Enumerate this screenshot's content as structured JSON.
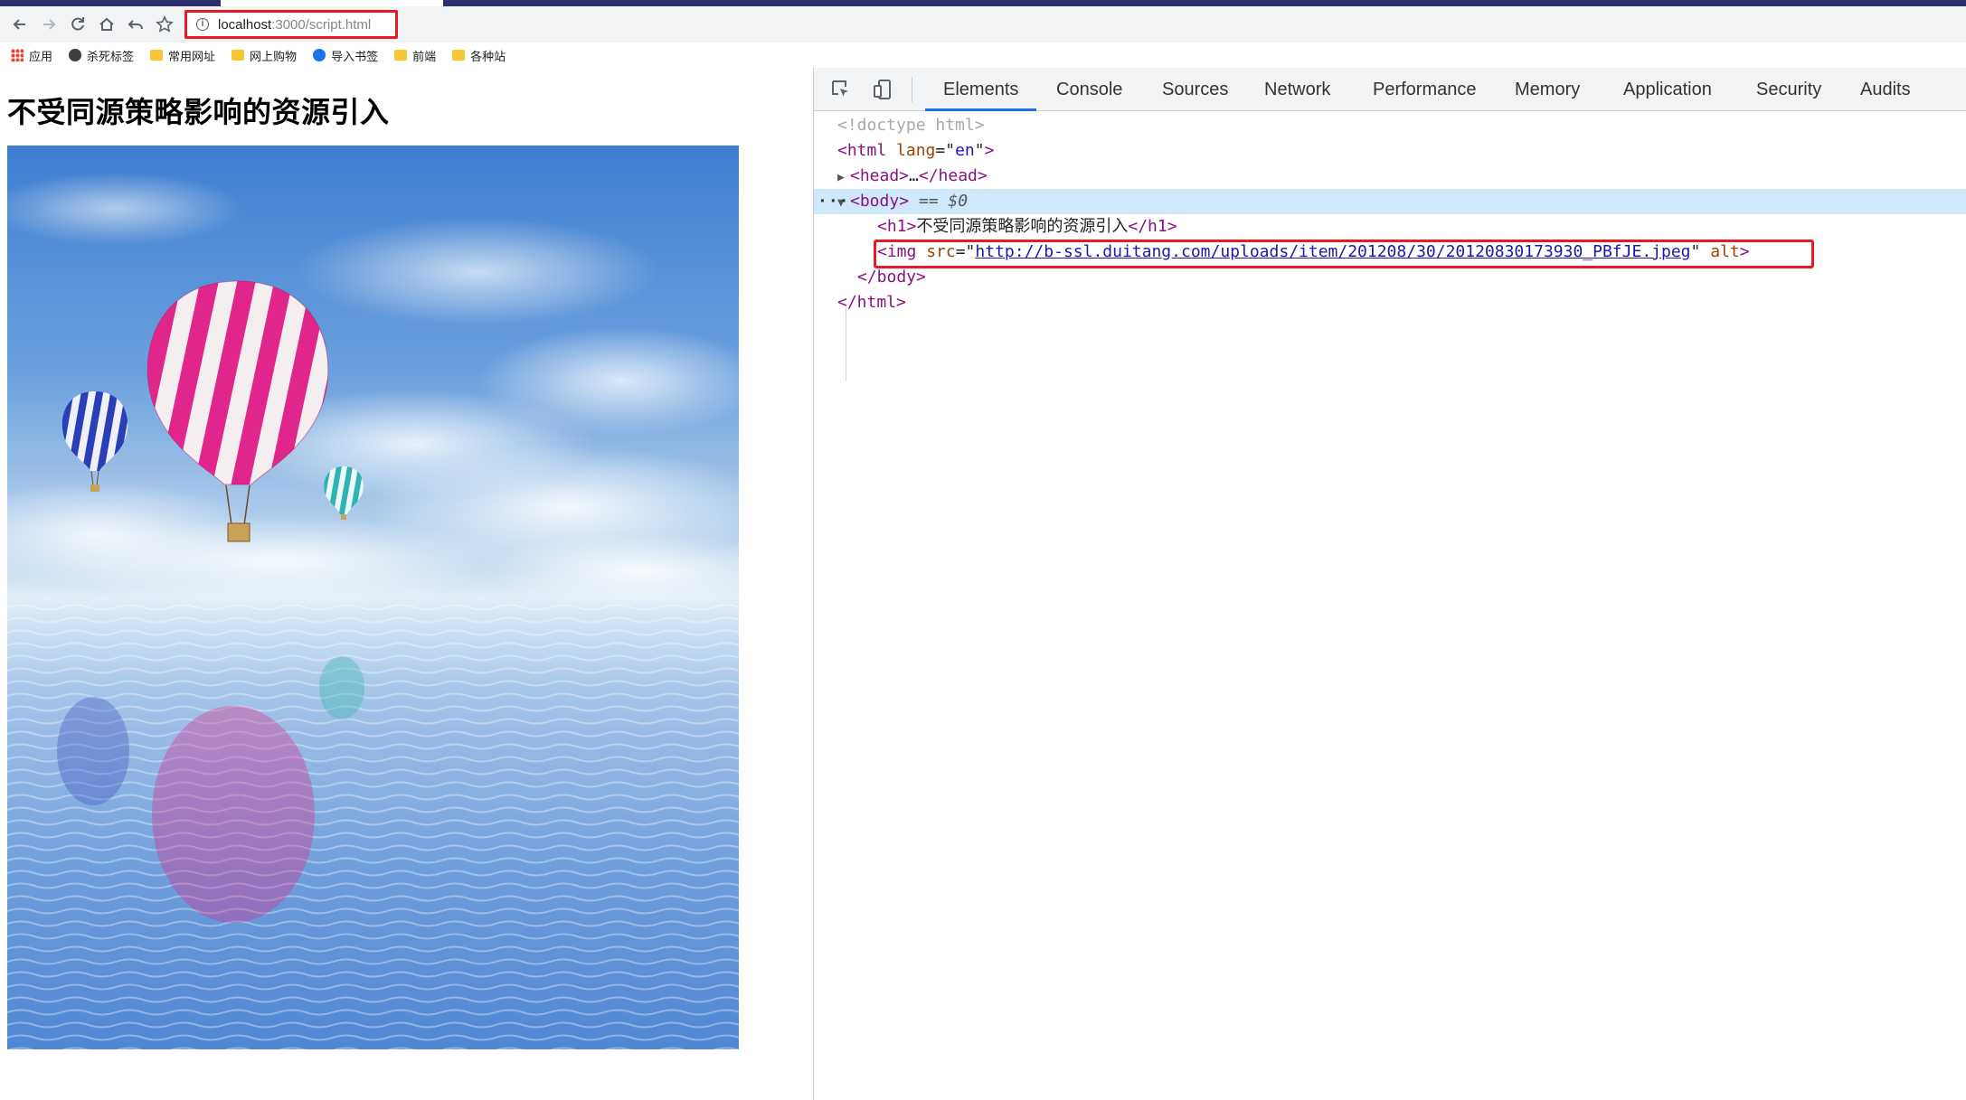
{
  "browser": {
    "url_host": "localhost",
    "url_path": ":3000/script.html",
    "bookmarks": [
      "应用",
      "杀死标签",
      "常用网址",
      "网上购物",
      "导入书签",
      "前端",
      "各种站"
    ]
  },
  "page": {
    "heading": "不受同源策略影响的资源引入"
  },
  "devtools": {
    "tabs": [
      "Elements",
      "Console",
      "Sources",
      "Network",
      "Performance",
      "Memory",
      "Application",
      "Security",
      "Audits"
    ],
    "active_tab": "Elements",
    "dom": {
      "doctype": "<!doctype html>",
      "html_open": "html",
      "html_attr": "lang",
      "html_attr_val": "en",
      "head_text": "…",
      "body_tag": "body",
      "body_marker": "== $0",
      "h1_text": "不受同源策略影响的资源引入",
      "img_attr": "src",
      "img_src": "http://b-ssl.duitang.com/uploads/item/201208/30/20120830173930_PBfJE.jpeg",
      "img_alt": "alt"
    }
  },
  "colors": {
    "highlight_red": "#e51c23",
    "selected_row": "#cfe8fc",
    "tab_underline": "#1a73e8"
  }
}
